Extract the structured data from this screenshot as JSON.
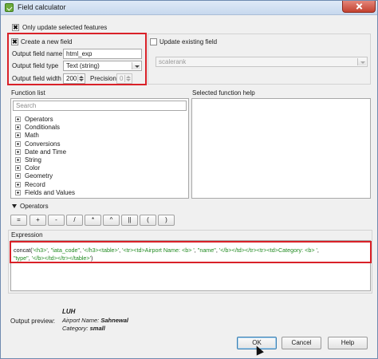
{
  "window": {
    "title": "Field calculator",
    "close_icon": "close-icon",
    "app_icon": "qgis-calculator-icon"
  },
  "only_selected": {
    "label": "Only update selected features",
    "checked": true
  },
  "create_field": {
    "label": "Create a new field",
    "checked": true,
    "name_label": "Output field name",
    "name_value": "html_exp",
    "type_label": "Output field type",
    "type_value": "Text (string)",
    "width_label": "Output field width",
    "width_value": "200",
    "precision_label": "Precision",
    "precision_value": "0"
  },
  "update_field": {
    "label": "Update existing field",
    "checked": false,
    "value": "scalerank"
  },
  "function_list": {
    "title": "Function list",
    "search_placeholder": "Search",
    "items": [
      "Operators",
      "Conditionals",
      "Math",
      "Conversions",
      "Date and Time",
      "String",
      "Color",
      "Geometry",
      "Record",
      "Fields and Values"
    ]
  },
  "function_help": {
    "title": "Selected function help"
  },
  "operators": {
    "title": "Operators",
    "buttons": [
      "=",
      "+",
      "-",
      "/",
      "*",
      "^",
      "||",
      "(",
      ")"
    ]
  },
  "expression": {
    "title": "Expression",
    "line1": [
      {
        "t": "concat(",
        "c": "fn"
      },
      {
        "t": "'<h3>'",
        "c": "s"
      },
      {
        "t": ", ",
        "c": "fn"
      },
      {
        "t": "\"iata_code\"",
        "c": "s"
      },
      {
        "t": ", ",
        "c": "fn"
      },
      {
        "t": "'</h3><table>'",
        "c": "s"
      },
      {
        "t": ", ",
        "c": "fn"
      },
      {
        "t": "'<tr><td>Airport Name: <b> '",
        "c": "s"
      },
      {
        "t": ", ",
        "c": "fn"
      },
      {
        "t": "\"name\"",
        "c": "s"
      },
      {
        "t": ", ",
        "c": "fn"
      },
      {
        "t": "'</b></td></tr><tr><td>Category: <b> '",
        "c": "s"
      },
      {
        "t": ",",
        "c": "fn"
      }
    ],
    "line2": [
      {
        "t": "\"type\"",
        "c": "s"
      },
      {
        "t": ", ",
        "c": "fn"
      },
      {
        "t": "'</b></td></tr></table>'",
        "c": "s"
      },
      {
        "t": ")",
        "c": "fn"
      }
    ]
  },
  "output_preview": {
    "label": "Output preview:",
    "heading": "LUH",
    "airport_label": "Airport Name:",
    "airport_value": "Sahnewal",
    "category_label": "Category:",
    "category_value": "small"
  },
  "buttons": {
    "ok": "OK",
    "cancel": "Cancel",
    "help": "Help"
  },
  "colors": {
    "highlight_box": "#d92128",
    "string_literal": "#1f8a1f"
  }
}
